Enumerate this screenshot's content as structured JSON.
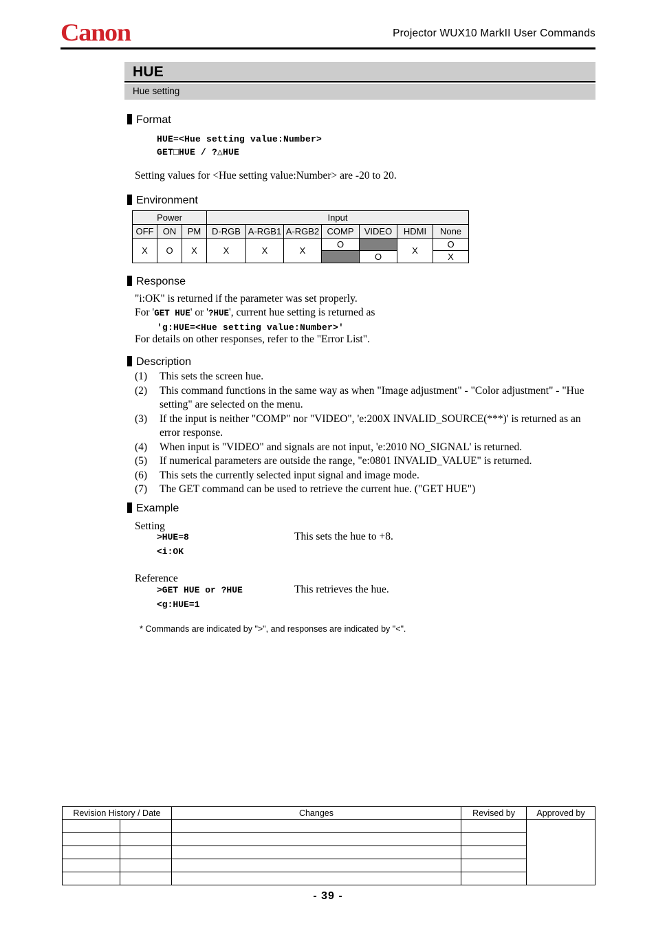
{
  "header": {
    "logo_text": "Canon",
    "logo_color": "#d1232a",
    "doc_title": "Projector  WUX10  MarkII  User  Commands"
  },
  "command": {
    "name": "HUE",
    "subtitle": "Hue setting"
  },
  "sections": {
    "format": {
      "heading": "Format",
      "lines": [
        "HUE=<Hue setting value:Number>",
        "GET□HUE   /   ?△HUE"
      ],
      "note": "Setting values for <Hue setting value:Number> are -20 to 20."
    },
    "environment": {
      "heading": "Environment",
      "group_headers": [
        "Power",
        "Input"
      ],
      "columns": [
        "OFF",
        "ON",
        "PM",
        "D-RGB",
        "A-RGB1",
        "A-RGB2",
        "COMP",
        "VIDEO",
        "HDMI",
        "None"
      ],
      "power_values": [
        "X",
        "O",
        "X"
      ],
      "input_simple": {
        "D-RGB": "X",
        "A-RGB1": "X",
        "A-RGB2": "X",
        "HDMI": "X"
      },
      "input_split": {
        "COMP": {
          "top": "O",
          "bottom": "",
          "top_gray": false,
          "bottom_gray": true
        },
        "VIDEO": {
          "top": "",
          "bottom": "O",
          "top_gray": true,
          "bottom_gray": false
        },
        "None": {
          "top": "O",
          "bottom": "X",
          "top_gray": false,
          "bottom_gray": false
        }
      },
      "gray_color": "#808080",
      "header_bg": "#efefef"
    },
    "response": {
      "heading": "Response",
      "line1_pre": "\"i:OK\" is returned if the parameter was set properly.",
      "line2_a": "For '",
      "line2_mono1": "GET HUE",
      "line2_b": "' or '",
      "line2_mono2": "?HUE",
      "line2_c": "', current hue setting is returned as",
      "line3_mono": "'g:HUE=<Hue setting value:Number>'",
      "line4": "For details on other responses, refer to the \"Error List\"."
    },
    "description": {
      "heading": "Description",
      "items": [
        {
          "num": "(1)",
          "text": "This sets the screen hue."
        },
        {
          "num": "(2)",
          "text": "This command functions in the same way as when \"Image adjustment\" - \"Color adjustment\" - \"Hue setting\" are selected on the menu."
        },
        {
          "num": "(3)",
          "text": "If the input is neither \"COMP\" nor \"VIDEO\", 'e:200X INVALID_SOURCE(***)' is returned as an error response."
        },
        {
          "num": "(4)",
          "text": "When input is \"VIDEO\" and signals are not input, 'e:2010 NO_SIGNAL' is returned."
        },
        {
          "num": "(5)",
          "text": "If numerical parameters are outside the range, \"e:0801 INVALID_VALUE\" is returned."
        },
        {
          "num": "(6)",
          "text": "This sets the currently selected input signal and image mode."
        },
        {
          "num": "(7)",
          "text": "The GET command can be used to retrieve the current hue. (\"GET HUE\")",
          "trailing_mono": "GET HUE"
        }
      ]
    },
    "example": {
      "heading": "Example",
      "setting_label": "Setting",
      "setting_cmd": ">HUE=8",
      "setting_note": "This sets the hue to +8.",
      "setting_resp": "<i:OK",
      "reference_label": "Reference",
      "reference_cmd": ">GET HUE or ?HUE",
      "reference_note": "This retrieves the hue.",
      "reference_resp": "<g:HUE=1",
      "footnote": "* Commands are indicated by \">\", and responses are indicated by \"<\"."
    }
  },
  "revision_table": {
    "headers": [
      "Revision History / Date",
      "Changes",
      "Revised by",
      "Approved by"
    ],
    "rows": [
      {
        "history": "",
        "date": "",
        "changes": "",
        "revised_by": ""
      },
      {
        "history": "",
        "date": "",
        "changes": "",
        "revised_by": ""
      },
      {
        "history": "",
        "date": "",
        "changes": "",
        "revised_by": ""
      },
      {
        "history": "",
        "date": "",
        "changes": "",
        "revised_by": ""
      },
      {
        "history": "",
        "date": "",
        "changes": "",
        "revised_by": ""
      }
    ],
    "approved_by_value": ""
  },
  "footer": {
    "page_number": "- 39 -"
  }
}
